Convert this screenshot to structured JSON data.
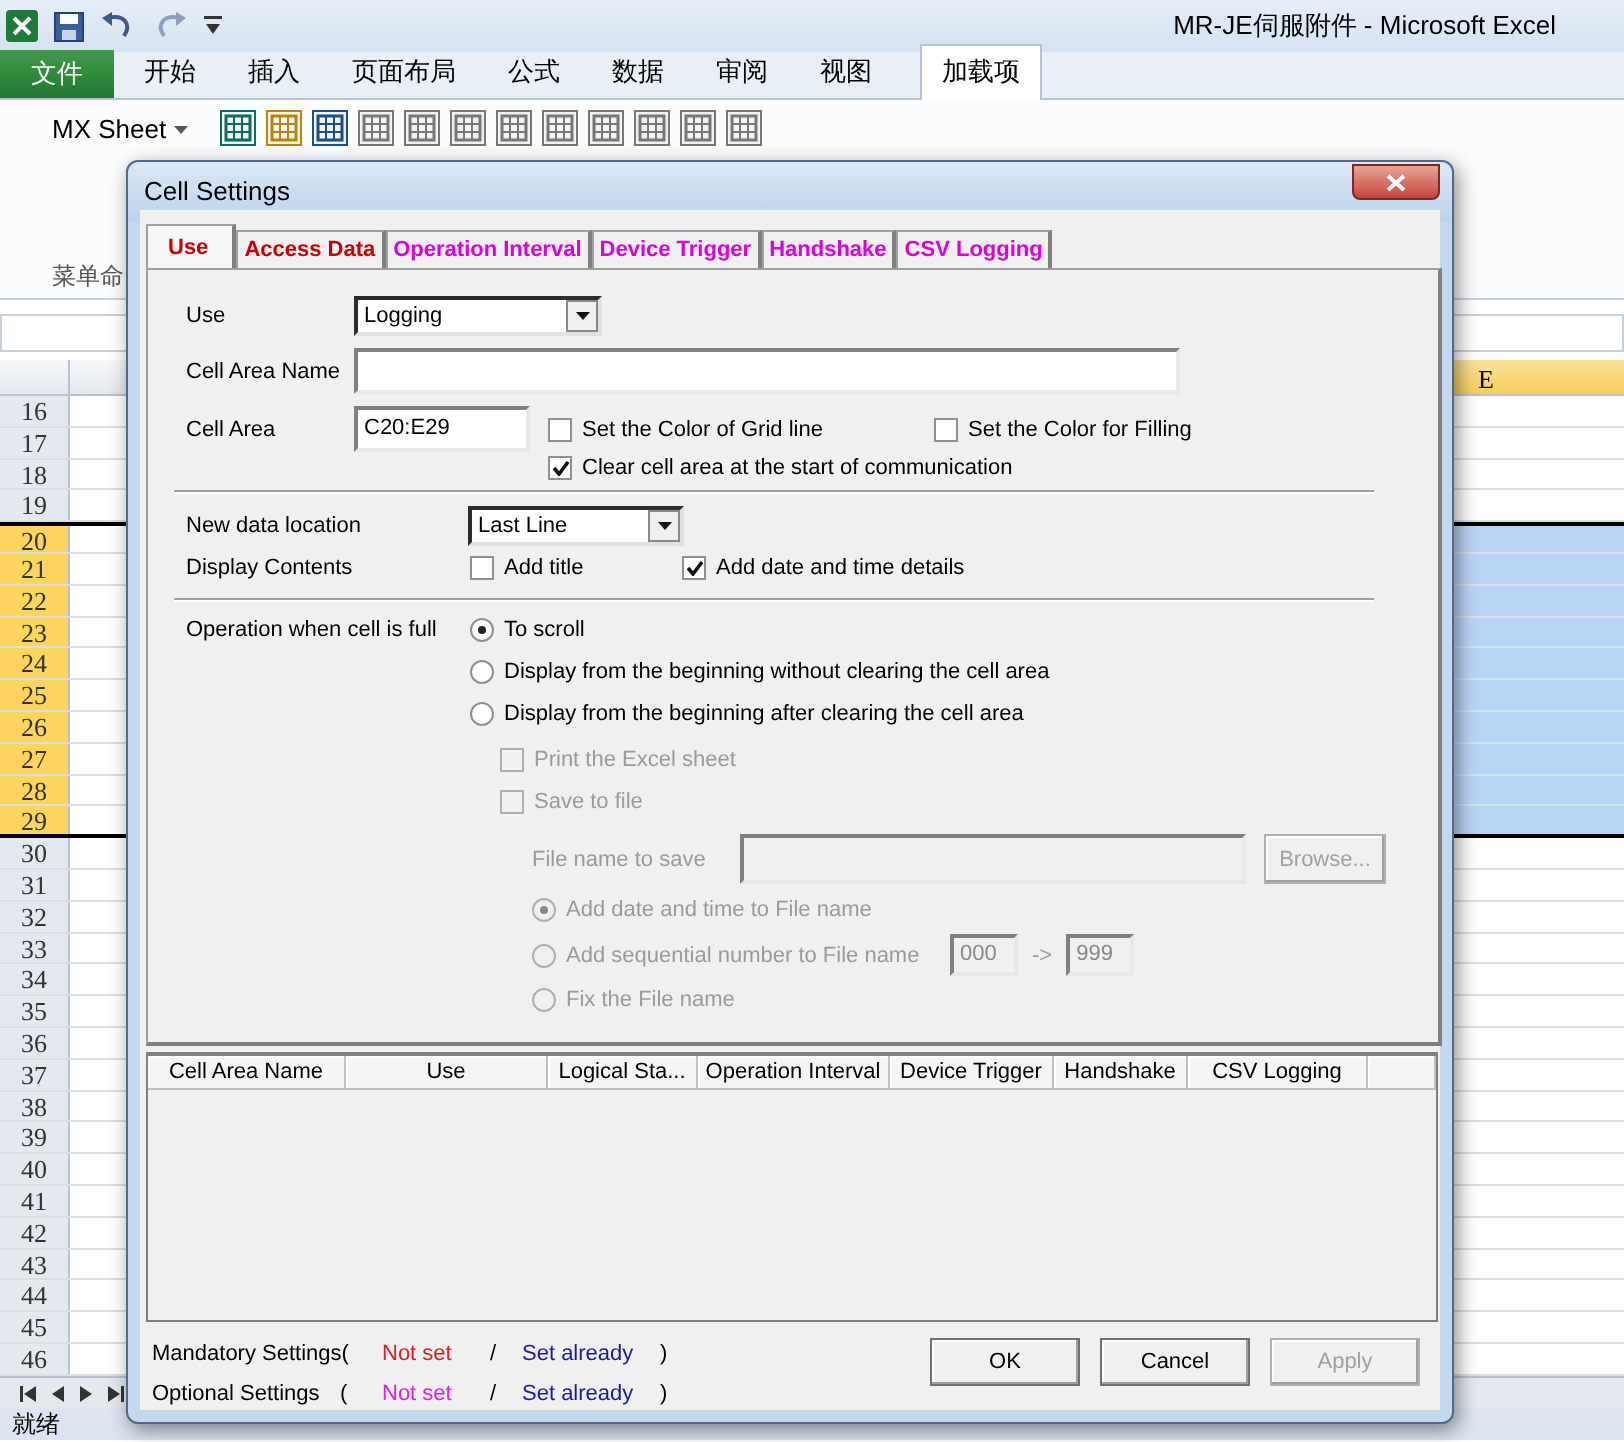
{
  "excel": {
    "title": "MR-JE伺服附件 - Microsoft Excel",
    "file_tab": "文件",
    "ribbon_tabs": [
      {
        "label": "开始",
        "selected": false
      },
      {
        "label": "插入",
        "selected": false
      },
      {
        "label": "页面布局",
        "selected": false
      },
      {
        "label": "公式",
        "selected": false
      },
      {
        "label": "数据",
        "selected": false
      },
      {
        "label": "审阅",
        "selected": false
      },
      {
        "label": "视图",
        "selected": false
      },
      {
        "label": "加载项",
        "selected": true
      }
    ],
    "mx_sheet_menu": "MX Sheet",
    "group_label": "菜单命",
    "column_header": "E",
    "rows": [
      {
        "number": "16",
        "selected": false
      },
      {
        "number": "17",
        "selected": false
      },
      {
        "number": "18",
        "selected": false
      },
      {
        "number": "19",
        "selected": false
      },
      {
        "number": "20",
        "selected": true
      },
      {
        "number": "21",
        "selected": true
      },
      {
        "number": "22",
        "selected": true
      },
      {
        "number": "23",
        "selected": true
      },
      {
        "number": "24",
        "selected": true
      },
      {
        "number": "25",
        "selected": true
      },
      {
        "number": "26",
        "selected": true
      },
      {
        "number": "27",
        "selected": true
      },
      {
        "number": "28",
        "selected": true
      },
      {
        "number": "29",
        "selected": true
      },
      {
        "number": "30",
        "selected": false
      },
      {
        "number": "31",
        "selected": false
      },
      {
        "number": "32",
        "selected": false
      },
      {
        "number": "33",
        "selected": false
      },
      {
        "number": "34",
        "selected": false
      },
      {
        "number": "35",
        "selected": false
      },
      {
        "number": "36",
        "selected": false
      },
      {
        "number": "37",
        "selected": false
      },
      {
        "number": "38",
        "selected": false
      },
      {
        "number": "39",
        "selected": false
      },
      {
        "number": "40",
        "selected": false
      },
      {
        "number": "41",
        "selected": false
      },
      {
        "number": "42",
        "selected": false
      },
      {
        "number": "43",
        "selected": false
      },
      {
        "number": "44",
        "selected": false
      },
      {
        "number": "45",
        "selected": false
      },
      {
        "number": "46",
        "selected": false
      }
    ],
    "status": "就绪"
  },
  "dialog": {
    "title": "Cell Settings",
    "tabs": [
      {
        "label": "Use",
        "selected": true,
        "color": "#cc0000"
      },
      {
        "label": "Access Data",
        "selected": false,
        "color": "#cc0000"
      },
      {
        "label": "Operation Interval",
        "selected": false,
        "color": "#dd00dd"
      },
      {
        "label": "Device Trigger",
        "selected": false,
        "color": "#dd00dd"
      },
      {
        "label": "Handshake",
        "selected": false,
        "color": "#dd00dd"
      },
      {
        "label": "CSV Logging",
        "selected": false,
        "color": "#dd00dd"
      }
    ],
    "use": {
      "label": "Use",
      "value": "Logging"
    },
    "cell_area_name": {
      "label": "Cell Area Name"
    },
    "cell_area": {
      "label": "Cell Area",
      "value": "C20:E29"
    },
    "cell_area_options": [
      {
        "label": "Set the Color of Grid line",
        "checked": false
      },
      {
        "label": "Set the Color for Filling",
        "checked": false
      },
      {
        "label": "Clear cell area at the start of communication",
        "checked": true
      }
    ],
    "new_data_location": {
      "label": "New data location",
      "value": "Last Line"
    },
    "display_contents": {
      "label": "Display Contents",
      "options": [
        {
          "label": "Add title",
          "checked": false
        },
        {
          "label": "Add date and time details",
          "checked": true
        }
      ]
    },
    "when_full": {
      "label": "Operation when cell is full",
      "options": [
        {
          "label": "To scroll",
          "selected": true
        },
        {
          "label": "Display from the beginning without clearing the cell area",
          "selected": false
        },
        {
          "label": "Display from the beginning after clearing the cell area",
          "selected": false
        }
      ]
    },
    "after_clear_options": [
      {
        "label": "Print the Excel sheet",
        "checked": false,
        "disabled": true
      },
      {
        "label": "Save to file",
        "checked": false,
        "disabled": true
      }
    ],
    "file_name": {
      "label": "File name to save",
      "disabled": true,
      "browse": "Browse...",
      "naming": [
        {
          "label": "Add date and time to File name",
          "selected": true
        },
        {
          "label": "Add sequential number to File name",
          "selected": false
        },
        {
          "label": "Fix the File name",
          "selected": false
        }
      ],
      "seq_from": "000",
      "arrow": "->",
      "seq_to": "999"
    },
    "list_columns": [
      "Cell Area Name",
      "Use",
      "Logical Sta...",
      "Operation Interval",
      "Device Trigger",
      "Handshake",
      "CSV Logging"
    ],
    "legend": [
      {
        "label": "Mandatory Settings(",
        "not_set": "Not set",
        "color": "#e02020",
        "slash": "/",
        "set": "Set already",
        "close": ")"
      },
      {
        "label": "Optional Settings",
        "open": "(",
        "not_set": "Not set",
        "color": "#e020e0",
        "slash": "/",
        "set": "Set already",
        "close": ")"
      }
    ],
    "buttons": [
      {
        "label": "OK",
        "disabled": false
      },
      {
        "label": "Cancel",
        "disabled": false
      },
      {
        "label": "Apply",
        "disabled": true
      }
    ]
  }
}
